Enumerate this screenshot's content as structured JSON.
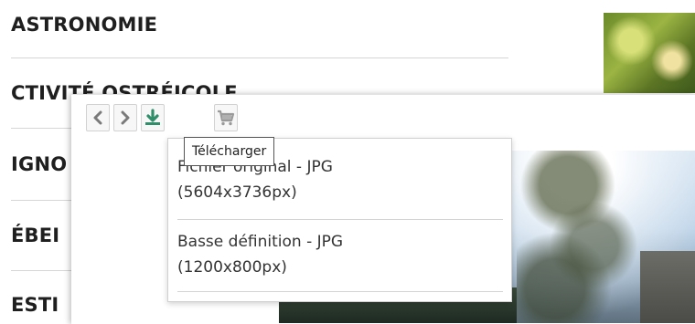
{
  "categories": [
    {
      "label": "ASTRONOMIE"
    },
    {
      "label": "CTIVITÉ OSTRÉICOLE"
    },
    {
      "label": "IGNO"
    },
    {
      "label": "ÉBEI"
    },
    {
      "label": "ESTI"
    }
  ],
  "toolbar": {
    "prev_icon": "chevron-left-icon",
    "next_icon": "chevron-right-icon",
    "download_icon": "download-icon",
    "cart_icon": "cart-icon",
    "download_tooltip": "Télécharger"
  },
  "download_menu": {
    "options": [
      {
        "line1": "Fichier original - JPG",
        "line2": "(5604x3736px)"
      },
      {
        "line1": "Basse définition - JPG",
        "line2": "(1200x800px)"
      }
    ]
  },
  "colors": {
    "download_accent": "#2f8f6b",
    "icon_gray": "#7a7a7a"
  }
}
